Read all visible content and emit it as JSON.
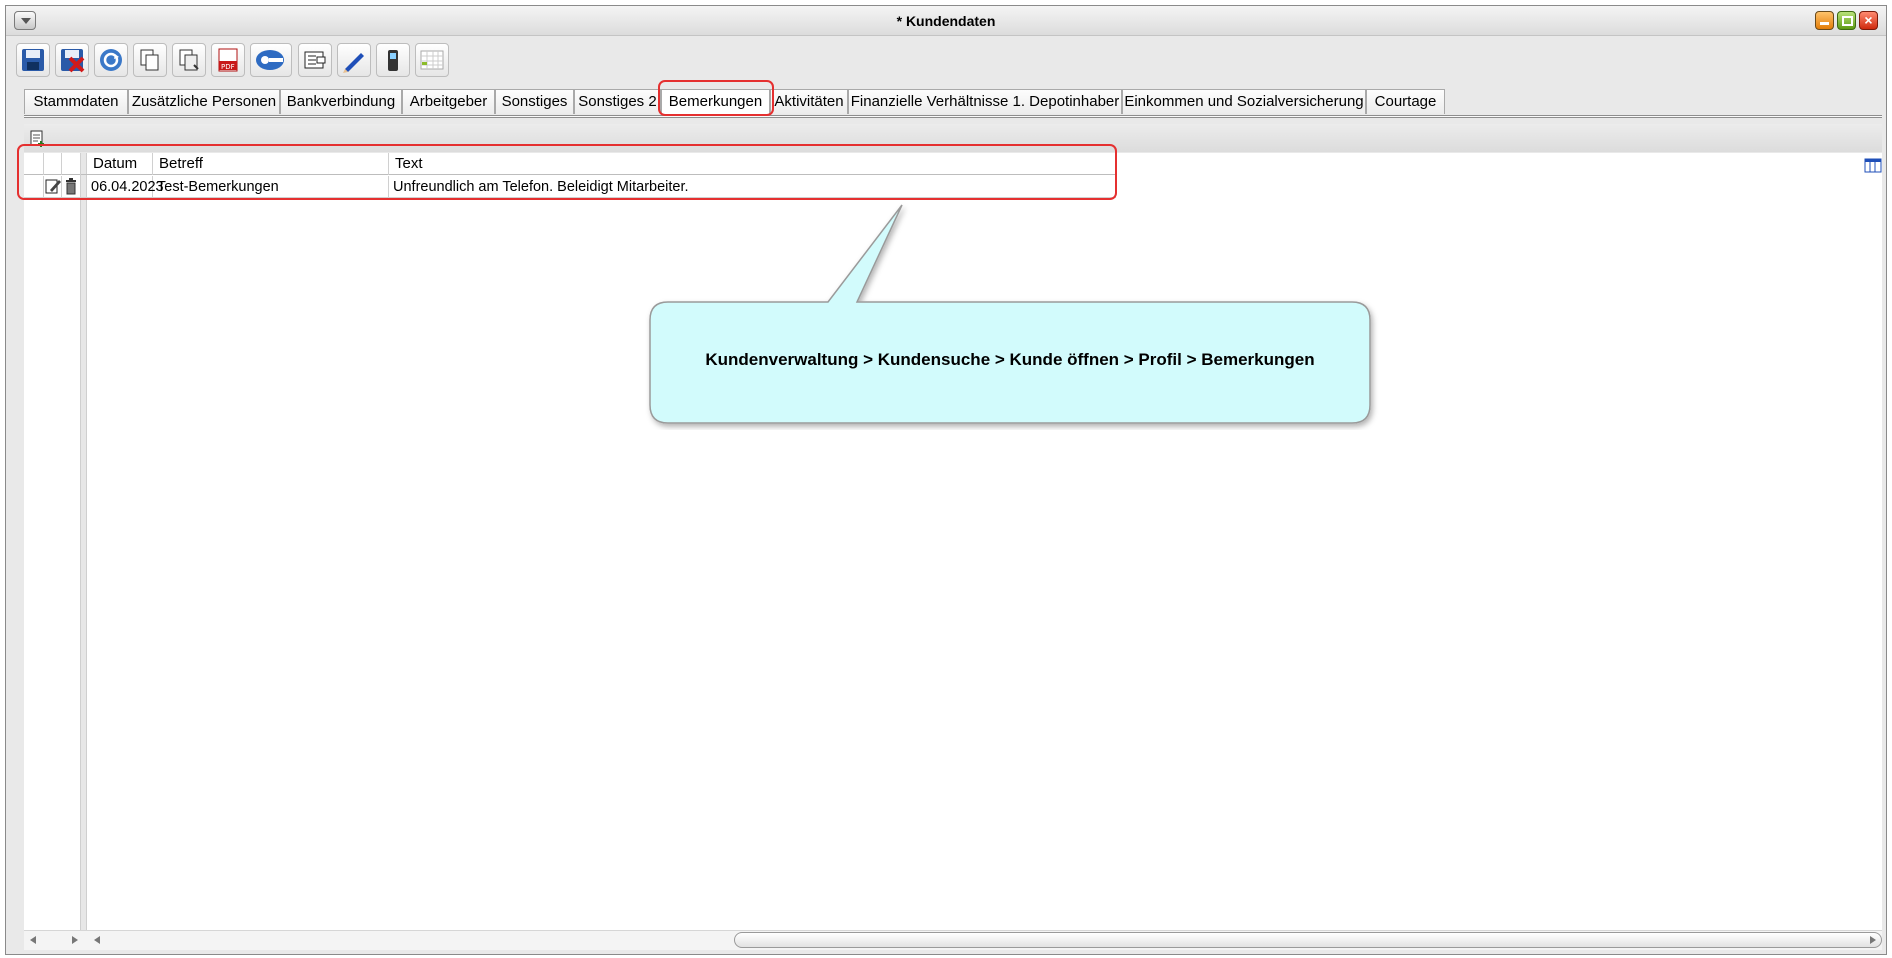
{
  "window": {
    "title": "* Kundendaten"
  },
  "toolbar": {
    "icons": [
      "save-icon",
      "save-close-icon",
      "refresh-icon",
      "copy-icon",
      "copy-special-icon",
      "pdf-icon",
      "key-icon",
      "letter-icon",
      "pen-icon",
      "phone-icon",
      "table-icon"
    ]
  },
  "tabs": [
    {
      "label": "Stammdaten"
    },
    {
      "label": "Zusätzliche Personen"
    },
    {
      "label": "Bankverbindung"
    },
    {
      "label": "Arbeitgeber"
    },
    {
      "label": "Sonstiges"
    },
    {
      "label": "Sonstiges 2"
    },
    {
      "label": "Bemerkungen",
      "active": true
    },
    {
      "label": "Aktivitäten"
    },
    {
      "label": "Finanzielle Verhältnisse 1. Depotinhaber"
    },
    {
      "label": "Einkommen und Sozialversicherung"
    },
    {
      "label": "Courtage"
    }
  ],
  "grid": {
    "columns": [
      "Datum",
      "Betreff",
      "Text"
    ],
    "rows": [
      {
        "datum": "06.04.2023",
        "betreff": "Test-Bemerkungen",
        "text": "Unfreundlich am Telefon. Beleidigt Mitarbeiter."
      }
    ]
  },
  "callout": {
    "text": "Kundenverwaltung > Kundensuche > Kunde öffnen > Profil > Bemerkungen"
  },
  "colors": {
    "highlight": "#e53030",
    "callout_fill": "#d2fbfc"
  }
}
